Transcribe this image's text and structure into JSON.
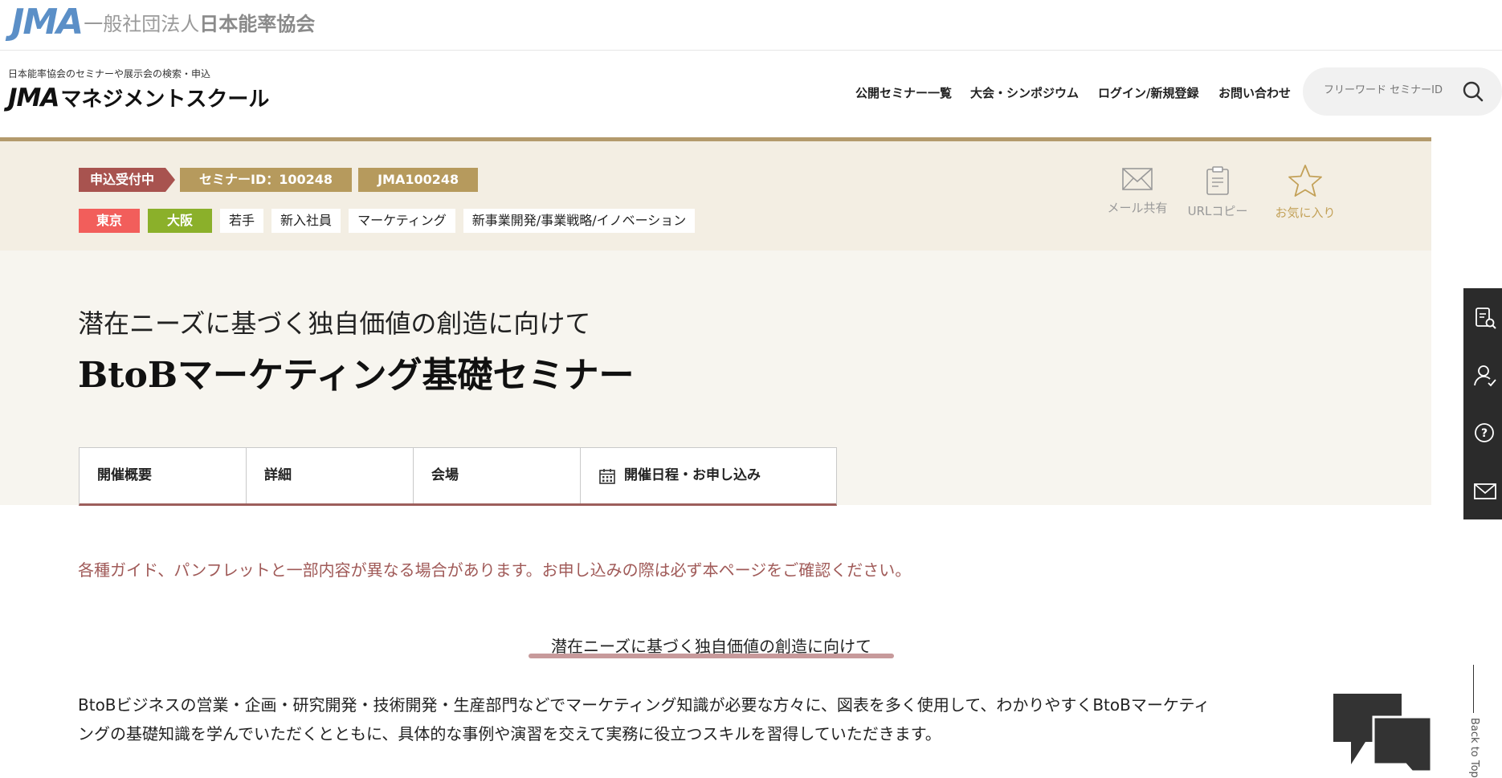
{
  "corp": {
    "logo_mark": "JMA",
    "org_prefix": "一般社団法人",
    "org_name": "日本能率協会"
  },
  "header": {
    "tagline": "日本能率協会のセミナーや展示会の検索・申込",
    "logo_mark": "JMA",
    "logo_text": "マネジメントスクール",
    "nav": [
      "公開セミナー一覧",
      "大会・シンポジウム",
      "ログイン/新規登録",
      "お問い合わせ"
    ],
    "search_placeholder": "フリーワード セミナーID"
  },
  "seminar": {
    "status": "申込受付中",
    "seminar_id": "セミナーID：100248",
    "code": "JMA100248",
    "tags": [
      "東京",
      "大阪",
      "若手",
      "新入社員",
      "マーケティング",
      "新事業開発/事業戦略/イノベーション"
    ],
    "actions": {
      "mail": "メール共有",
      "url": "URLコピー",
      "favorite": "お気に入り"
    }
  },
  "hero": {
    "subtitle": "潜在ニーズに基づく独自価値の創造に向けて",
    "title": "BtoBマーケティング基礎セミナー",
    "tabs": [
      "開催概要",
      "詳細",
      "会場",
      "開催日程・お申し込み"
    ]
  },
  "content": {
    "notice": "各種ガイド、パンフレットと一部内容が異なる場合があります。お申し込みの際は必ず本ページをご確認ください。",
    "heading": "潜在ニーズに基づく独自価値の創造に向けて",
    "body_line1": "BtoBビジネスの営業・企画・研究開発・技術開発・生産部門などでマーケティング知識が必要な方々に、図表を多く使用して、わかりやすくBtoBマーケティ",
    "body_line2": "ングの基礎知識を学んでいただくとともに、具体的な事例や演習を交えて実務に役立つスキルを習得していただきます。"
  },
  "back_to_top": "Back to Top",
  "colors": {
    "status": "#a8534f",
    "gold": "#b69a5d",
    "tokyo": "#f25e5b",
    "osaka": "#8bb02a",
    "notice": "#a05a58",
    "band": "#f3eee3"
  }
}
